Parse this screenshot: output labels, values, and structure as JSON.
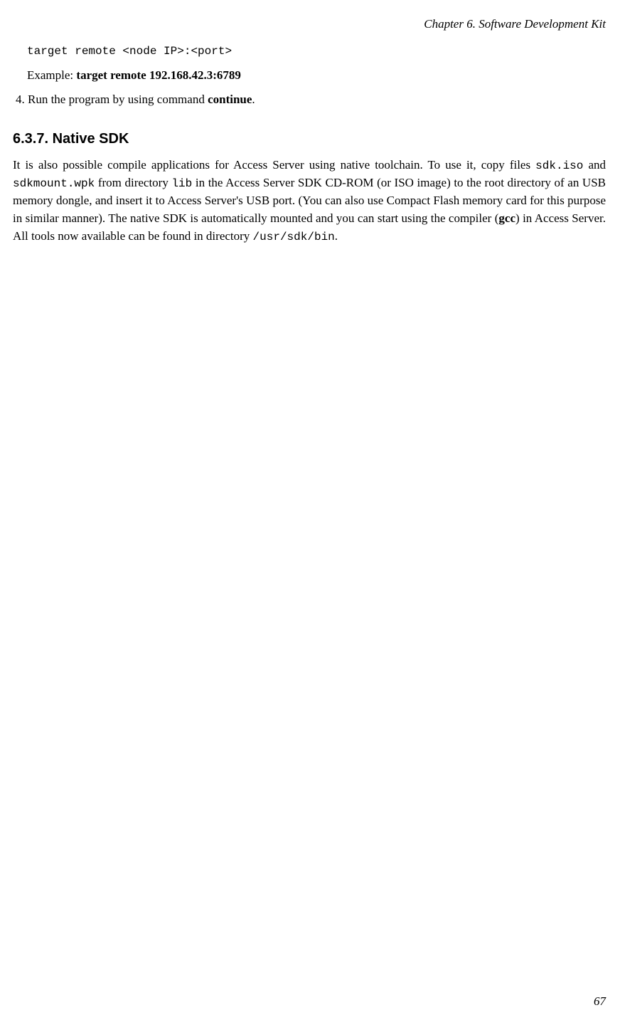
{
  "header": {
    "chapter": "Chapter 6. Software Development Kit"
  },
  "content": {
    "code_command": "target remote <node IP>:<port>",
    "example_label": "Example: ",
    "example_value": "target remote 192.168.42.3:6789",
    "step4_prefix": "4. Run the program by using command ",
    "step4_bold": "continue",
    "step4_suffix": ".",
    "section_heading": "6.3.7. Native SDK",
    "para": {
      "t1": "It is also possible compile applications for Access Server using native toolchain. To use it, copy files ",
      "c1": "sdk.iso",
      "t2": " and ",
      "c2": "sdkmount.wpk",
      "t3": " from directory ",
      "c3": "lib",
      "t4": " in the Access Server SDK CD-ROM (or ISO image) to the root directory of an USB memory dongle, and insert it to Access Server's USB port. (You can also use Compact Flash memory card for this purpose in similar manner). The native SDK is automatically mounted and you can start using the compiler (",
      "b1": "gcc",
      "t5": ") in Access Server. All tools now available can be found in directory ",
      "c4": "/usr/sdk/bin",
      "t6": "."
    }
  },
  "footer": {
    "page_number": "67"
  }
}
